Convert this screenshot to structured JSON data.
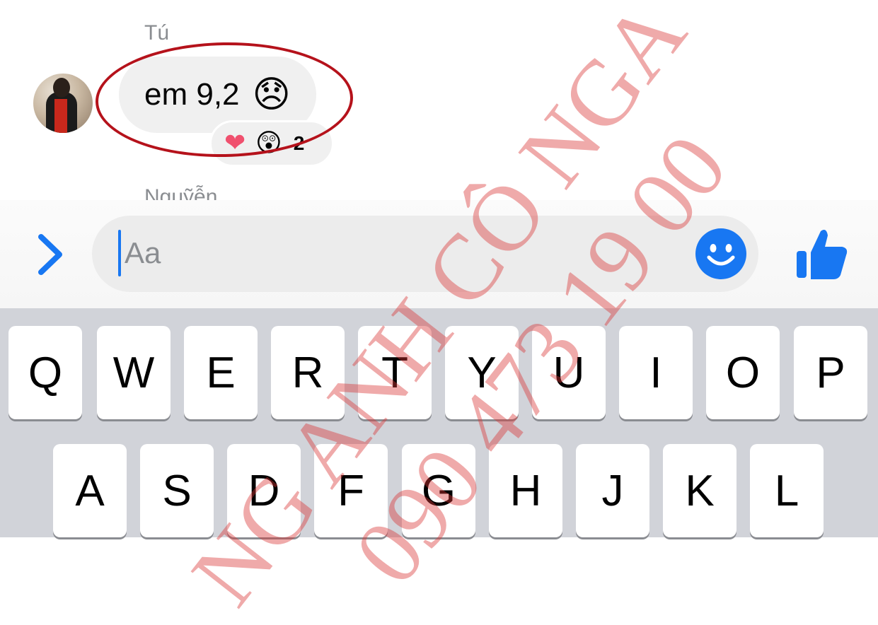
{
  "chat": {
    "sender_name": "Tú",
    "message_text": "em 9,2",
    "message_emoji": "😞",
    "reactions": [
      {
        "glyph": "❤",
        "name": "heart-reaction"
      },
      {
        "glyph": "😲",
        "name": "wow-reaction"
      }
    ],
    "reaction_count": "2",
    "next_sender_name_partial": "Nguỹễn"
  },
  "composer": {
    "placeholder": "Aa",
    "icons": [
      "chevron-right-icon",
      "smiley-icon",
      "thumbs-up-icon"
    ],
    "accent_color": "#1877f2"
  },
  "keyboard": {
    "row1": [
      "Q",
      "W",
      "E",
      "R",
      "T",
      "Y",
      "U",
      "I",
      "O",
      "P"
    ],
    "row2": [
      "A",
      "S",
      "D",
      "F",
      "G",
      "H",
      "J",
      "K",
      "L"
    ]
  },
  "annotation": {
    "oval_color": "#b5121b"
  },
  "watermark": {
    "line1": "NG ANH CÔ NGA",
    "line2": "090 473 19 00",
    "color": "#d83434"
  }
}
